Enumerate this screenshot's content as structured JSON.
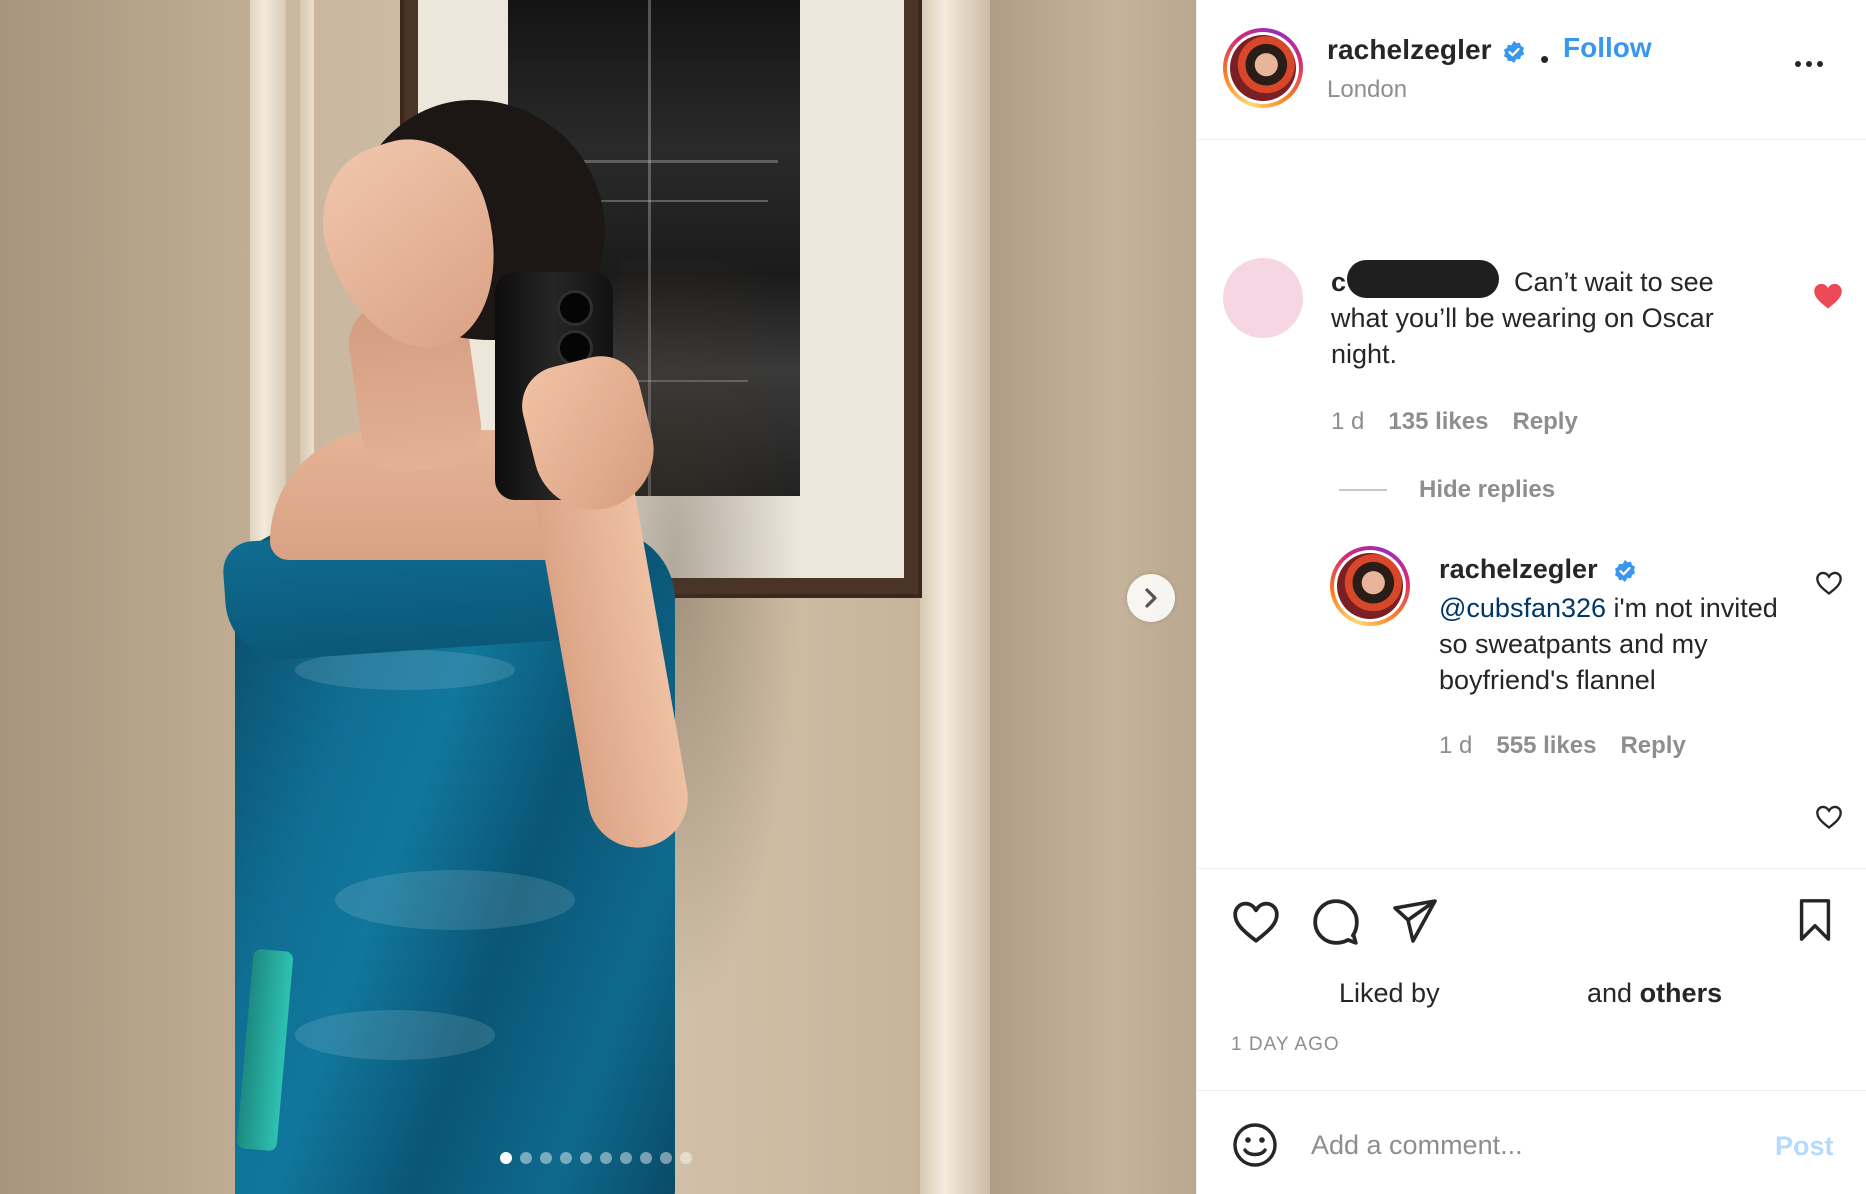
{
  "post": {
    "carousel": {
      "slide_count": 10,
      "active_index": 0,
      "next_icon": "chevron-right-icon"
    }
  },
  "header": {
    "username": "rachelzegler",
    "verified_icon": "verified-badge-icon",
    "separator": "•",
    "follow_label": "Follow",
    "location": "London",
    "more_icon": "more-horizontal-icon"
  },
  "comments": [
    {
      "user_initial": "c",
      "text": "Can’t wait to see what you’ll be wearing on Oscar night.",
      "time": "1 d",
      "likes": "135 likes",
      "reply_label": "Reply",
      "liked": true
    }
  ],
  "replies_toggle": {
    "label": "Hide replies"
  },
  "replies": [
    {
      "username": "rachelzegler",
      "mention": "@cubsfan326",
      "text": " i'm not invited so sweatpants and my boyfriend's flannel",
      "time": "1 d",
      "likes": "555 likes",
      "reply_label": "Reply",
      "liked": false
    }
  ],
  "actions": {
    "like_icon": "heart-icon",
    "comment_icon": "comment-icon",
    "share_icon": "send-icon",
    "save_icon": "bookmark-icon"
  },
  "likes_summary": {
    "liked_by": "Liked by",
    "and": "and",
    "others": "others"
  },
  "timestamp": "1 DAY AGO",
  "comment_box": {
    "emoji_icon": "emoji-icon",
    "placeholder": "Add a comment...",
    "post_label": "Post"
  },
  "colors": {
    "link_blue": "#3897f0",
    "post_disabled": "#b3dbff",
    "heart_red": "#ed4956",
    "secondary_text": "#8e8e8e",
    "mention": "#00376b"
  }
}
